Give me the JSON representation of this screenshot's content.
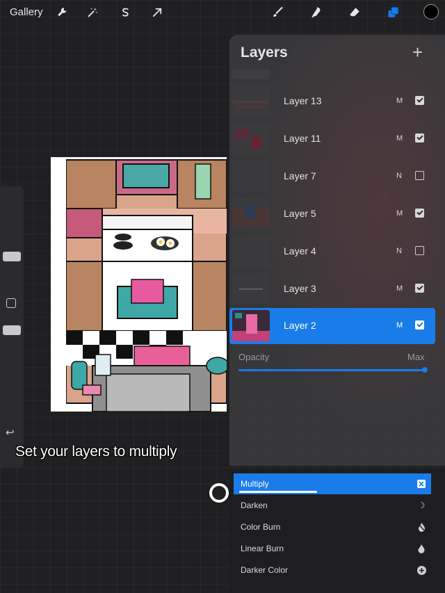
{
  "toolbar": {
    "gallery_label": "Gallery",
    "left_icons": [
      "wrench-icon",
      "magic-wand-icon",
      "selection-s-icon",
      "transform-arrow-icon"
    ],
    "right_icons": [
      "brush-icon",
      "smudge-icon",
      "eraser-icon",
      "layers-icon"
    ],
    "accent_color": "#1a7ce8",
    "current_color": "#000000"
  },
  "layers_panel": {
    "title": "Layers",
    "add_label": "+",
    "layers": [
      {
        "name": "Layer 13",
        "mode": "M",
        "visible": true
      },
      {
        "name": "Layer 11",
        "mode": "M",
        "visible": true
      },
      {
        "name": "Layer 7",
        "mode": "N",
        "visible": false
      },
      {
        "name": "Layer 5",
        "mode": "M",
        "visible": true
      },
      {
        "name": "Layer 4",
        "mode": "N",
        "visible": false
      },
      {
        "name": "Layer 3",
        "mode": "M",
        "visible": true
      },
      {
        "name": "Layer 2",
        "mode": "M",
        "visible": true,
        "selected": true
      }
    ],
    "opacity_label": "Opacity",
    "opacity_max_label": "Max",
    "opacity_value": 1.0
  },
  "blend_modes": {
    "items": [
      {
        "label": "Multiply",
        "icon": "multiply-x-icon",
        "selected": true
      },
      {
        "label": "Darken",
        "icon": "crescent-moon-icon"
      },
      {
        "label": "Color Burn",
        "icon": "burn-flame-icon"
      },
      {
        "label": "Linear Burn",
        "icon": "flame-icon"
      },
      {
        "label": "Darker Color",
        "icon": "plus-circle-icon"
      }
    ]
  },
  "caption": "Set your layers to multiply"
}
